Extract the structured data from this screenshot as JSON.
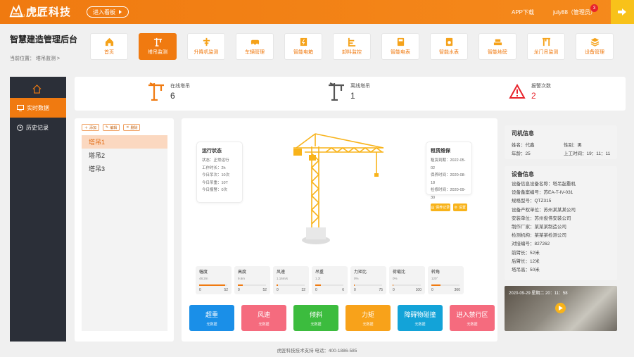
{
  "brand": {
    "name": "虎匠科技",
    "sub": "HUJIANG"
  },
  "header": {
    "board_btn": "进入看板",
    "app_download": "APP下载",
    "user": "july88（管理员）",
    "notif_count": "3"
  },
  "page": {
    "title": "智慧建造管理后台",
    "breadcrumb": "当前位置：  塔吊监测  >"
  },
  "nav": [
    {
      "label": "首页",
      "icon": "home-icon"
    },
    {
      "label": "塔吊监测",
      "icon": "tower-crane-icon"
    },
    {
      "label": "升降机监测",
      "icon": "elevator-icon"
    },
    {
      "label": "车辆管理",
      "icon": "car-icon"
    },
    {
      "label": "智能电箱",
      "icon": "power-box-icon"
    },
    {
      "label": "卸料监控",
      "icon": "unloading-icon"
    },
    {
      "label": "智能电表",
      "icon": "meter-icon"
    },
    {
      "label": "智能水表",
      "icon": "water-meter-icon"
    },
    {
      "label": "智能地磅",
      "icon": "scale-icon"
    },
    {
      "label": "龙门吊监测",
      "icon": "gantry-icon"
    },
    {
      "label": "设备管理",
      "icon": "layers-icon"
    }
  ],
  "sidebar": {
    "items": [
      {
        "label": "实时数据"
      },
      {
        "label": "历史记录"
      }
    ]
  },
  "stats": [
    {
      "label": "在线塔吊",
      "value": "6"
    },
    {
      "label": "离线塔吊",
      "value": "1"
    },
    {
      "label": "报警次数",
      "value": "2"
    }
  ],
  "list": {
    "add": "添加",
    "edit": "编辑",
    "delete": "删除",
    "items": [
      "塔吊1",
      "塔吊2",
      "塔吊3"
    ]
  },
  "run_status": {
    "title": "运行状态",
    "lines": [
      "状态：正常运行",
      "工作时长：2h",
      "今日吊次：10次",
      "今日吊重：10T",
      "今日报警：0次"
    ]
  },
  "maintenance": {
    "title": "租赁维保",
    "lines": [
      "租赁到期：2022-05-02",
      "保养时间：2020-08-18",
      "检修时间：2020-09-30"
    ],
    "record_btn": "保养记录",
    "settings_btn": "设置"
  },
  "gauges": [
    {
      "label": "幅度",
      "value": "48.2m",
      "min": "0",
      "max": "52",
      "pct": 0.93
    },
    {
      "label": "高度",
      "value": "9.6m",
      "min": "0",
      "max": "52",
      "pct": 0.18
    },
    {
      "label": "风速",
      "value": "1.16m/s",
      "min": "0",
      "max": "32",
      "pct": 0.04
    },
    {
      "label": "吊重",
      "value": "1.2t",
      "min": "0",
      "max": "6",
      "pct": 0.2
    },
    {
      "label": "力矩比",
      "value": "0%",
      "min": "0",
      "max": "75",
      "pct": 0.0
    },
    {
      "label": "荷载比",
      "value": "0%",
      "min": "0",
      "max": "100",
      "pct": 0.0
    },
    {
      "label": "转角",
      "value": "120°",
      "min": "0",
      "max": "360",
      "pct": 0.33
    }
  ],
  "alerts": [
    {
      "title": "超重",
      "sub": "无数据",
      "color": "#1a8fe8"
    },
    {
      "title": "风速",
      "sub": "无数据",
      "color": "#f56b7e"
    },
    {
      "title": "倾斜",
      "sub": "无数据",
      "color": "#3cbc3e"
    },
    {
      "title": "力矩",
      "sub": "无数据",
      "color": "#f8a21a"
    },
    {
      "title": "障碍物碰撞",
      "sub": "无数据",
      "color": "#13a3d8"
    },
    {
      "title": "进入禁行区",
      "sub": "无数据",
      "color": "#f56b7e"
    }
  ],
  "driver": {
    "title": "司机信息",
    "name": "姓名：代鑫",
    "gender": "性别：男",
    "age": "年龄：25",
    "work_time": "上工时间：19：11：11"
  },
  "device": {
    "title": "设备信息",
    "lines": [
      "设备信息设备名称：塔吊起重机",
      "设备备案编号：苏EA-T-IV-031",
      "规格型号：QTZ315",
      "设备产权单位：苏州某某某公司",
      "安装单位：苏州俊伟安装公司",
      "制作厂家：某某某制造公司",
      "检测机构：某某某检测公司",
      "对接编号：827262",
      "前臂长：52米",
      "后臂长：12米",
      "塔吊高：50米"
    ]
  },
  "video": {
    "timestamp": "2020-09-29  星期二  20：11：58"
  },
  "footer": "虎匠科技技术支持    电话：400-1886-585"
}
